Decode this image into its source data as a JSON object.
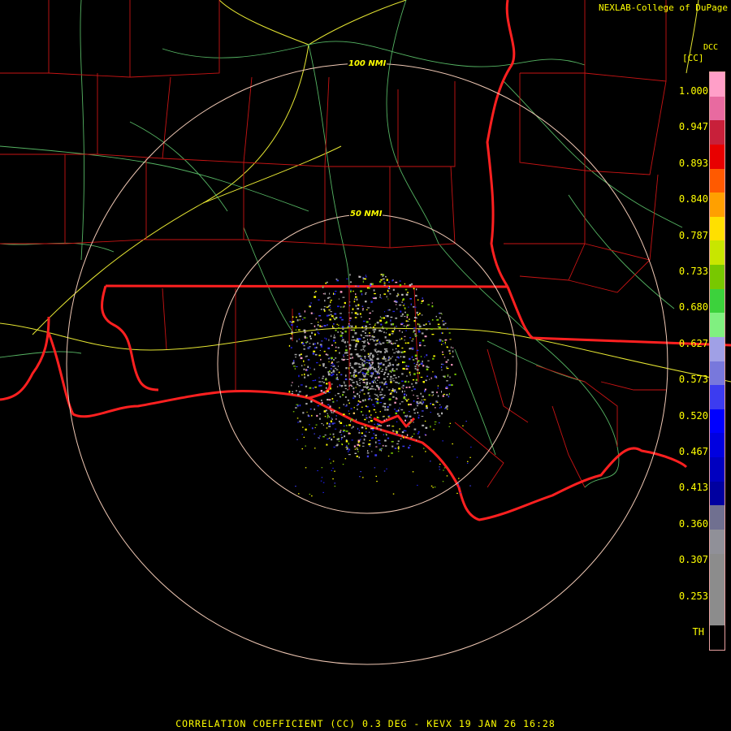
{
  "header": {
    "credit": "NEXLAB-College of DuPage",
    "product_code": "DCC",
    "units": "[CC]"
  },
  "rings": [
    {
      "label": "100 NMI"
    },
    {
      "label": "50 NMI"
    }
  ],
  "legend": {
    "ticks": [
      "1.000",
      "0.947",
      "0.893",
      "0.840",
      "0.787",
      "0.733",
      "0.680",
      "0.627",
      "0.573",
      "0.520",
      "0.467",
      "0.413",
      "0.360",
      "0.307",
      "0.253"
    ],
    "threshold_label": "TH",
    "colors": [
      "#ff9fc8",
      "#e86aa0",
      "#c8203a",
      "#e80000",
      "#ff5a00",
      "#ffa000",
      "#ffe000",
      "#c8e600",
      "#78c800",
      "#3cd23c",
      "#80f080",
      "#a0a0e6",
      "#7878dc",
      "#3c3cf0",
      "#0000ff",
      "#0000e0",
      "#0000c0",
      "#0000a0",
      "#707090",
      "#909098",
      "#8c8c8c",
      "#8c8c8c",
      "#8c8c8c",
      "#000000"
    ]
  },
  "caption": "CORRELATION COEFFICIENT (CC) 0.3 DEG - KEVX 19 JAN 26 16:28"
}
